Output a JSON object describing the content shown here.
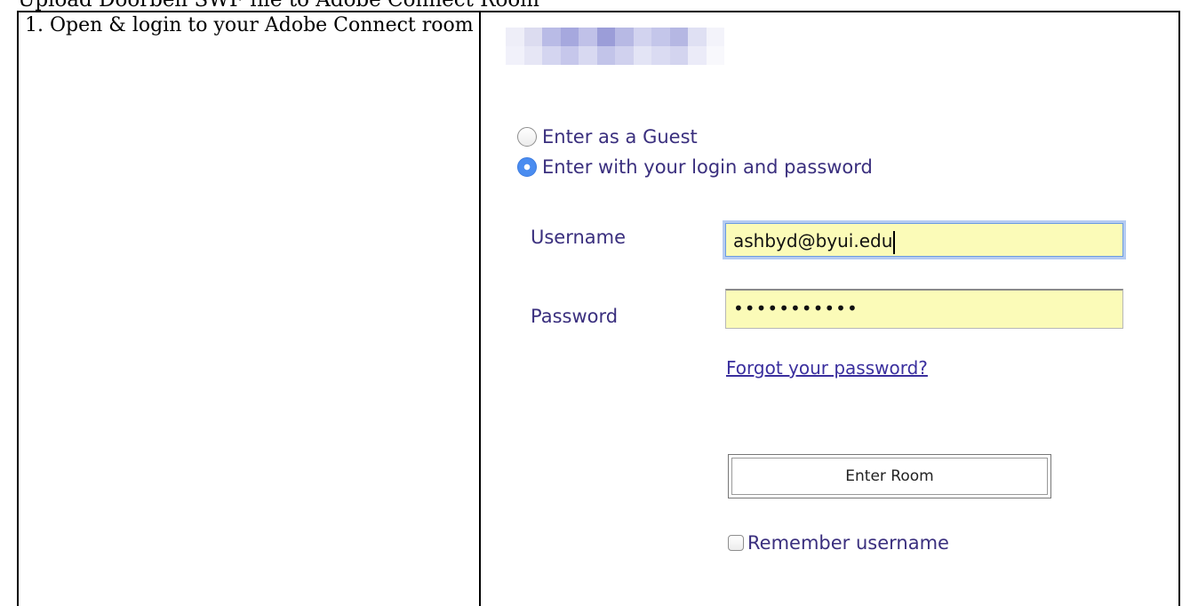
{
  "document": {
    "heading": "Upload Doorbell SWF file to Adobe Connect Room",
    "step": "1. Open & login to your Adobe Connect room"
  },
  "login": {
    "guest_label": "Enter as a Guest",
    "member_label": "Enter with your login and password",
    "selected_option": "member",
    "username_label": "Username",
    "username_value": "ashbyd@byui.edu",
    "password_label": "Password",
    "password_mask": "•••••••••••",
    "forgot_link": "Forgot your password?",
    "enter_button": "Enter Room",
    "remember_label": "Remember username"
  },
  "colors": {
    "label_text": "#3a2f7e",
    "input_fill": "#fbfbb8",
    "radio_selected": "#4a8cf0"
  }
}
